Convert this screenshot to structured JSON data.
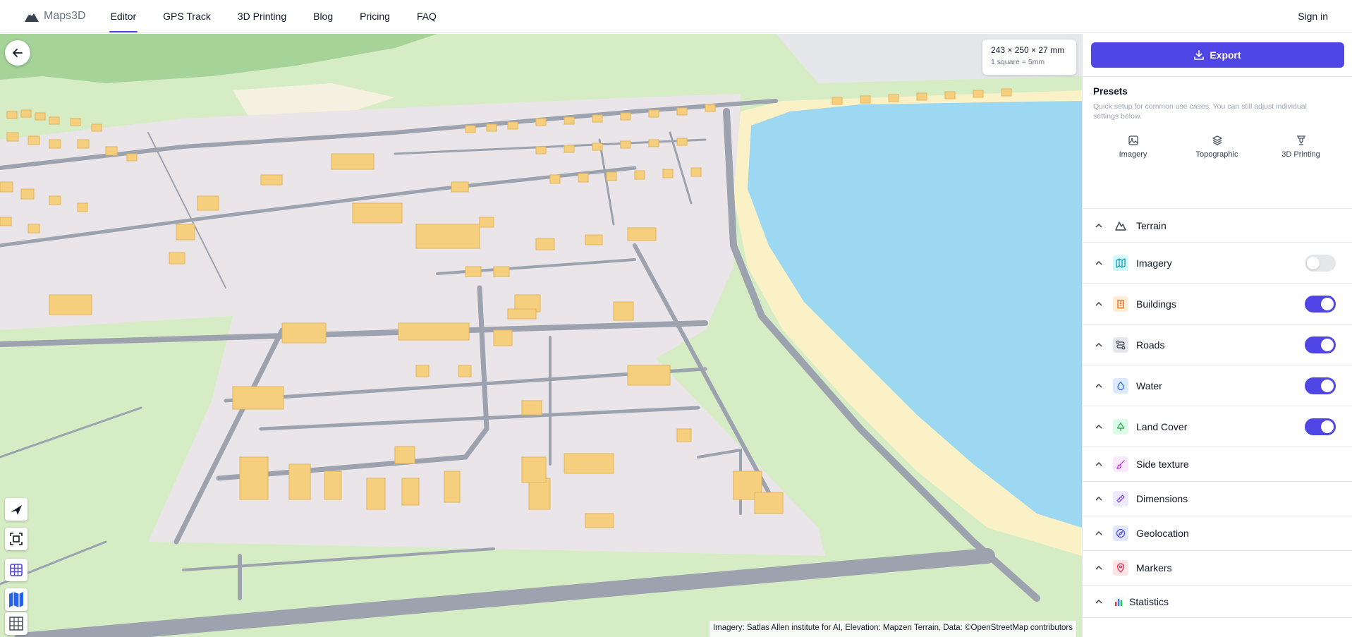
{
  "nav": {
    "brand": "Maps3D",
    "links": [
      "Editor",
      "GPS Track",
      "3D Printing",
      "Blog",
      "Pricing",
      "FAQ"
    ],
    "active": "Editor",
    "signin": "Sign in"
  },
  "map": {
    "dimensions": "243 × 250 × 27 mm",
    "scale": "1 square = 5mm",
    "attribution": "Imagery: Satlas Allen institute for AI, Elevation: Mapzen Terrain, Data: ©OpenStreetMap contributors",
    "tools": [
      "navigate-icon",
      "fit-view-icon",
      "grid-icon",
      "map-style-icon",
      "base-grid-icon"
    ]
  },
  "sidebar": {
    "export_label": "Export",
    "presets": {
      "title": "Presets",
      "description": "Quick setup for common use cases. You can still adjust individual settings below.",
      "items": [
        "Imagery",
        "Topographic",
        "3D Printing"
      ]
    },
    "layers": [
      {
        "label": "Terrain",
        "icon": "terrain-icon"
      },
      {
        "label": "Imagery",
        "icon": "map-icon",
        "enabled": false
      },
      {
        "label": "Buildings",
        "icon": "building-icon",
        "enabled": true
      },
      {
        "label": "Roads",
        "icon": "route-icon",
        "enabled": true
      },
      {
        "label": "Water",
        "icon": "droplet-icon",
        "enabled": true
      },
      {
        "label": "Land Cover",
        "icon": "tree-icon",
        "enabled": true
      },
      {
        "label": "Side texture",
        "icon": "brush-icon"
      },
      {
        "label": "Dimensions",
        "icon": "ruler-icon"
      },
      {
        "label": "Geolocation",
        "icon": "compass-icon"
      },
      {
        "label": "Markers",
        "icon": "pin-icon"
      },
      {
        "label": "Statistics",
        "icon": "chart-icon"
      }
    ]
  },
  "colors": {
    "accent": "#4f46e5",
    "water": "#9dd8f3",
    "building": "#f5cf7d",
    "road": "#9ca3af",
    "landcover": "#d6ecc4",
    "urban": "#e9e5e8",
    "beach": "#fbf1c7"
  }
}
